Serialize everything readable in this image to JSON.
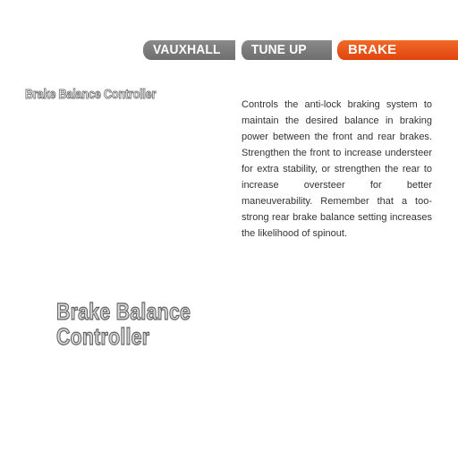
{
  "tabs": [
    {
      "label": "VAUXHALL",
      "active": false
    },
    {
      "label": "TUNE UP",
      "active": false
    },
    {
      "label": "BRAKE",
      "active": true
    }
  ],
  "colors": {
    "tab_inactive": "#7a7a7a",
    "tab_active": "#e8501a",
    "text": "#333333"
  },
  "heading": {
    "small": "Brake Balance Controller",
    "large_line1": "Brake Balance",
    "large_line2": "Controller"
  },
  "description": "Controls the anti-lock braking system to maintain the desired balance in braking power between the front and rear brakes. Strengthen the front to increase understeer for extra stability, or strengthen the rear to increase oversteer for better maneuverability. Remember that a too-strong rear brake balance setting increases the likelihood of spinout."
}
